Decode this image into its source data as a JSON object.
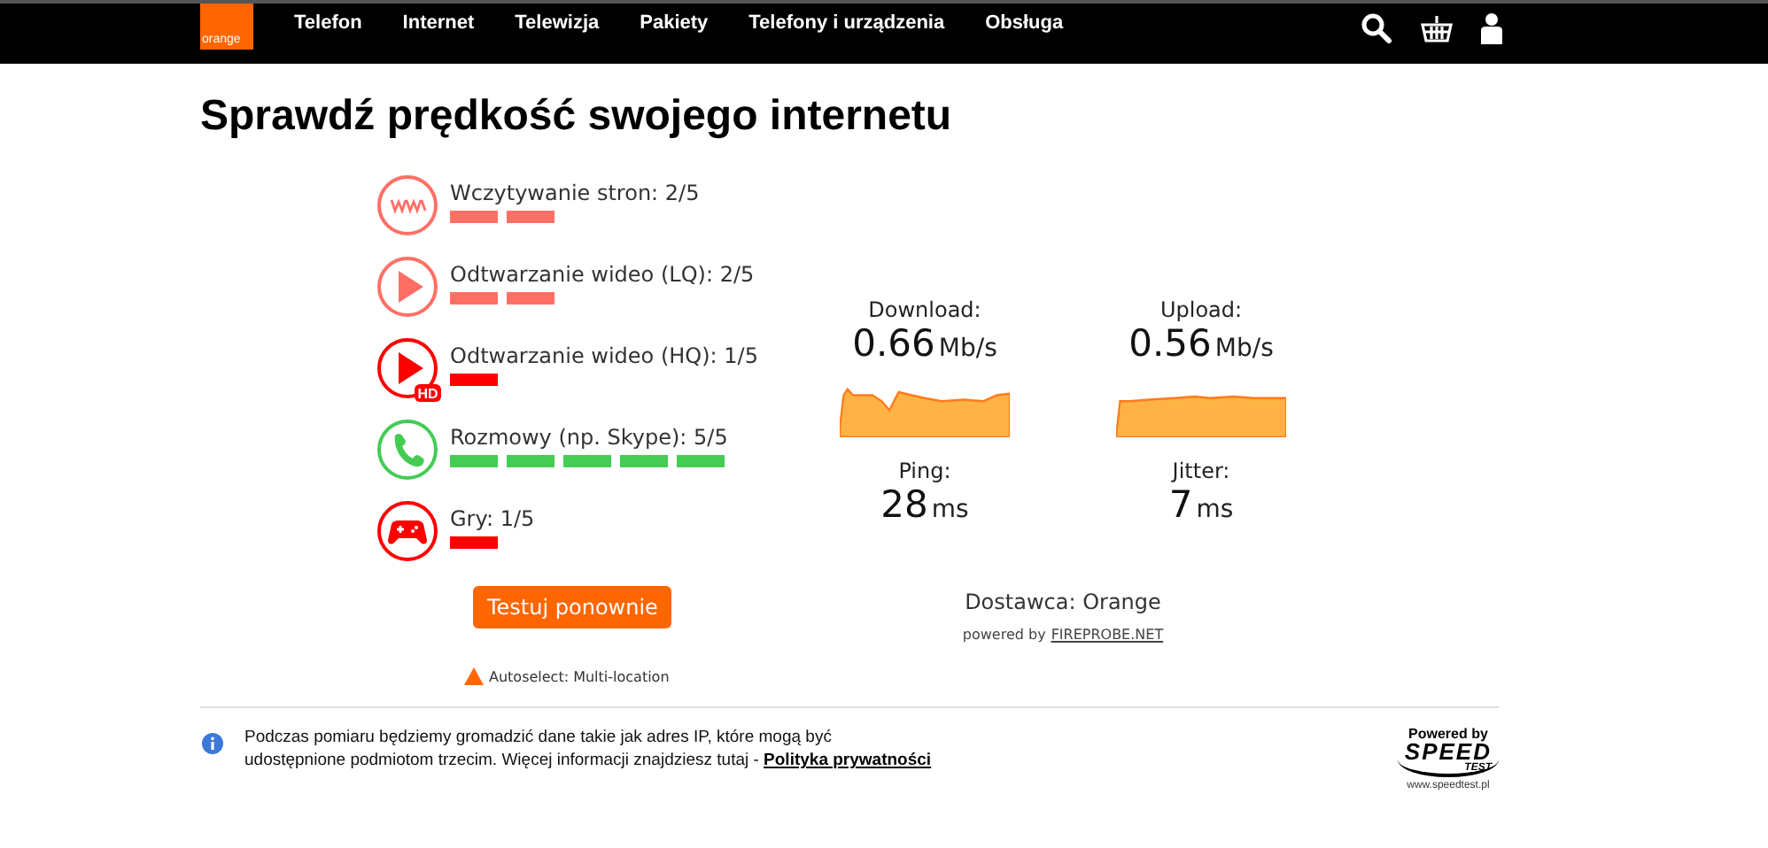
{
  "header": {
    "logo": "orange",
    "nav": [
      {
        "label": "Telefon"
      },
      {
        "label": "Internet"
      },
      {
        "label": "Telewizja"
      },
      {
        "label": "Pakiety"
      },
      {
        "label": "Telefony i urządzenia"
      },
      {
        "label": "Obsługa"
      }
    ]
  },
  "title": "Sprawdź prędkość swojego internetu",
  "quality": [
    {
      "kind": "www",
      "label": "Wczytywanie stron: 2/5",
      "segments": [
        true,
        true,
        false,
        false,
        false
      ],
      "color": "#ff6f66"
    },
    {
      "kind": "play",
      "label": "Odtwarzanie wideo (LQ): 2/5",
      "segments": [
        true,
        true,
        false,
        false,
        false
      ],
      "color": "#ff6f66"
    },
    {
      "kind": "play-hd",
      "label": "Odtwarzanie wideo (HQ): 1/5",
      "segments": [
        true,
        false,
        false,
        false,
        false
      ],
      "color": "#ff0000",
      "badge": "HD"
    },
    {
      "kind": "phone",
      "label": "Rozmowy (np. Skype): 5/5",
      "segments": [
        true,
        true,
        true,
        true,
        true
      ],
      "color": "#44cc55"
    },
    {
      "kind": "gamepad",
      "label": "Gry: 1/5",
      "segments": [
        true,
        false,
        false,
        false,
        false
      ],
      "color": "#ff0000"
    }
  ],
  "retest_button": "Testuj ponownie",
  "server": "Autoselect: Multi-location",
  "speeds": [
    {
      "label": "Download:",
      "value": "0.66",
      "unit": "Mb/s"
    },
    {
      "label": "Upload:",
      "value": "0.56",
      "unit": "Mb/s"
    }
  ],
  "latency": [
    {
      "label": "Ping:",
      "value": "28",
      "unit": "ms"
    },
    {
      "label": "Jitter:",
      "value": "7",
      "unit": "ms"
    }
  ],
  "provider": "Dostawca: Orange",
  "powered": {
    "text": "powered by",
    "link": "FIREPROBE.NET"
  },
  "footer": {
    "note": "Podczas pomiaru będziemy gromadzić dane takie jak adres IP, które mogą być udostępnione podmiotom trzecim. Więcej informacji znajdziesz tutaj - ",
    "link": "Polityka prywatności",
    "badge": {
      "top": "Powered by",
      "brand": "SPEED",
      "sub": "TEST",
      "url": "www.speedtest.pl"
    }
  }
}
